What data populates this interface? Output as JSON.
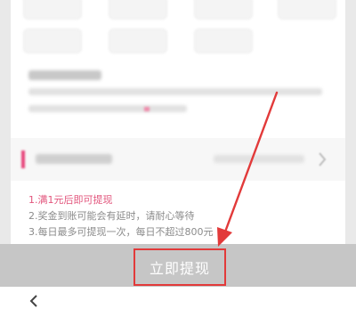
{
  "withdraw_rules": {
    "rule1": "1.满1元后即可提现",
    "rule2": "2.奖金到账可能会有延时，请耐心等待",
    "rule3": "3.每日最多可提现一次，每日不超过800元"
  },
  "withdraw_button": {
    "label": "立即提现"
  },
  "colors": {
    "accent": "#e2557c",
    "highlight_box": "#e23a3a",
    "button_band": "#c6c6c6"
  },
  "icons": {
    "back": "back-icon",
    "record_chevron": "chevron-right-icon",
    "annotation": "red-arrow-icon"
  }
}
